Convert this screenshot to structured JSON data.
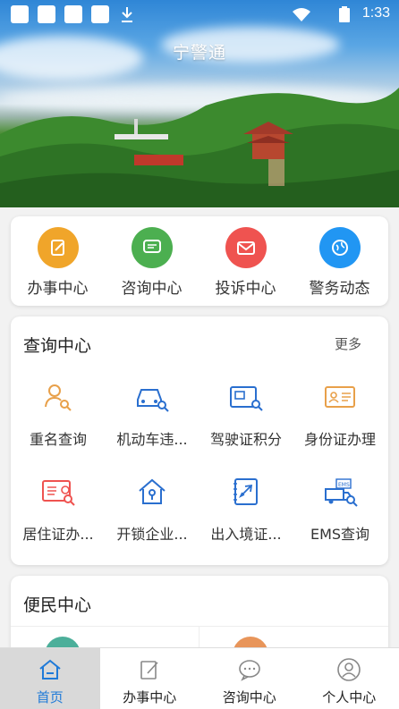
{
  "status_bar": {
    "time": "1:33"
  },
  "app": {
    "title": "宁警通"
  },
  "quick_actions": [
    {
      "label": "办事中心",
      "icon": "edit-icon",
      "color": "#f0a52a"
    },
    {
      "label": "咨询中心",
      "icon": "chat-icon",
      "color": "#4caf50"
    },
    {
      "label": "投诉中心",
      "icon": "mail-icon",
      "color": "#ef5350"
    },
    {
      "label": "警务动态",
      "icon": "globe-icon",
      "color": "#2196f3"
    }
  ],
  "query_center": {
    "title": "查询中心",
    "more": "更多",
    "items": [
      {
        "label": "重名查询",
        "icon": "person-search-icon"
      },
      {
        "label": "机动车违...",
        "icon": "car-search-icon"
      },
      {
        "label": "驾驶证积分",
        "icon": "license-search-icon"
      },
      {
        "label": "身份证办理",
        "icon": "id-card-icon"
      },
      {
        "label": "居住证办...",
        "icon": "residence-card-icon"
      },
      {
        "label": "开锁企业...",
        "icon": "house-lock-icon"
      },
      {
        "label": "出入境证...",
        "icon": "passport-plane-icon"
      },
      {
        "label": "EMS查询",
        "icon": "ems-truck-icon"
      }
    ]
  },
  "convenience_center": {
    "title": "便民中心"
  },
  "bottom_nav": [
    {
      "label": "首页",
      "icon": "home-icon",
      "active": true
    },
    {
      "label": "办事中心",
      "icon": "edit-icon",
      "active": false
    },
    {
      "label": "咨询中心",
      "icon": "chat-icon",
      "active": false
    },
    {
      "label": "个人中心",
      "icon": "user-icon",
      "active": false
    }
  ],
  "colors": {
    "accent": "#1f7ad8",
    "icon_orange": "#e8a04a",
    "icon_blue": "#2a6fcf",
    "icon_red": "#ef5350"
  }
}
